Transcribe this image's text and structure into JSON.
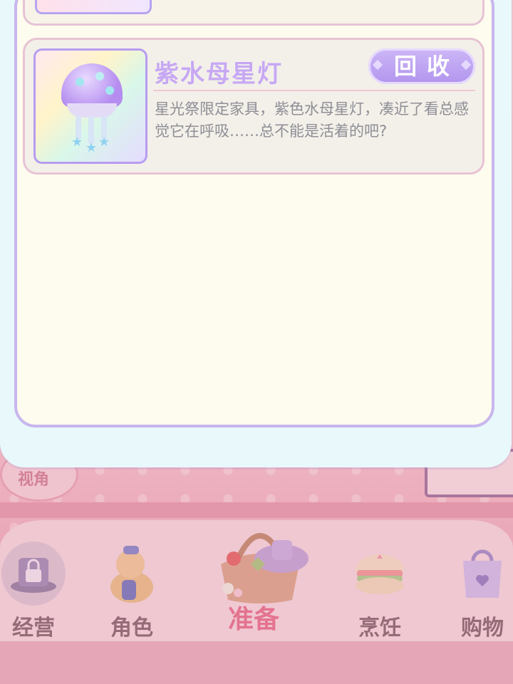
{
  "item": {
    "name": "紫水母星灯",
    "recycle_label": "回收",
    "description": "星光祭限定家具，紫色水母星灯，凑近了看总感觉它在呼吸……总不能是活着的吧?"
  },
  "background": {
    "view_label": "视角",
    "nav": [
      {
        "label": "经营",
        "icon": "lock-hat-icon"
      },
      {
        "label": "角色",
        "icon": "character-icon"
      },
      {
        "label": "准备",
        "icon": "basket-icon"
      },
      {
        "label": "烹饪",
        "icon": "sandwich-icon"
      },
      {
        "label": "购物",
        "icon": "shopping-bag-icon"
      }
    ]
  },
  "colors": {
    "accent": "#c7a8f4",
    "button": "#b195ee",
    "active_nav": "#e5577a"
  }
}
